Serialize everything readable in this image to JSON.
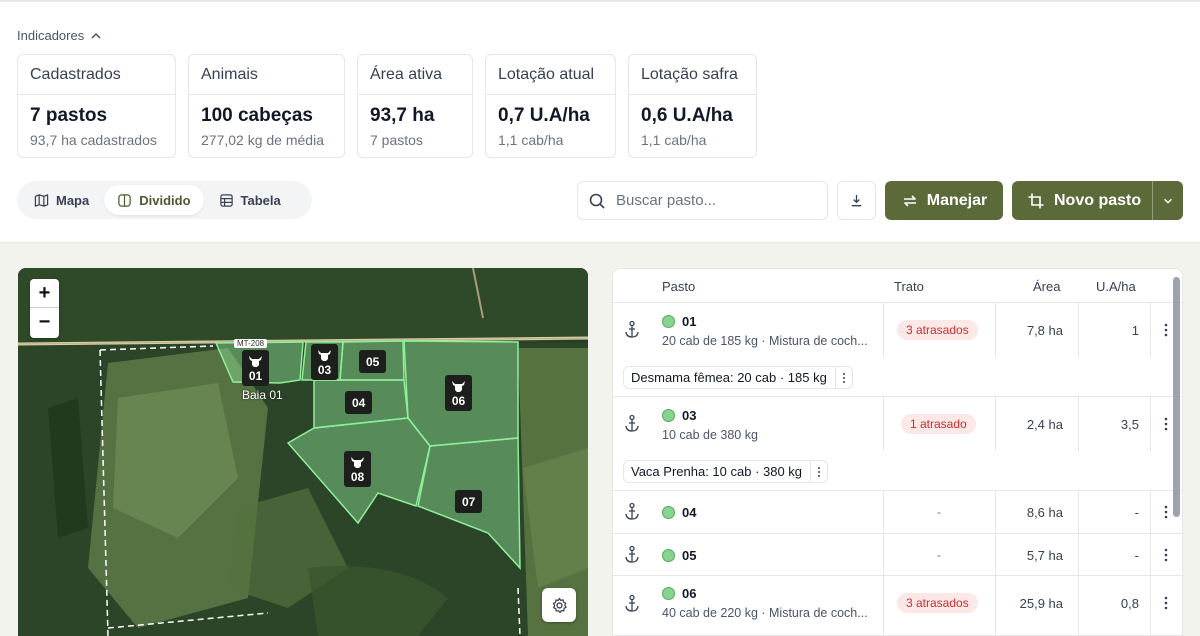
{
  "indicators": {
    "label": "Indicadores",
    "cards": [
      {
        "title": "Cadastrados",
        "value": "7 pastos",
        "sub": "93,7 ha cadastrados"
      },
      {
        "title": "Animais",
        "value": "100 cabeças",
        "sub": "277,02 kg de média"
      },
      {
        "title": "Área ativa",
        "value": "93,7 ha",
        "sub": "7 pastos"
      },
      {
        "title": "Lotação atual",
        "value": "0,7 U.A/ha",
        "sub": "1,1 cab/ha"
      },
      {
        "title": "Lotação safra",
        "value": "0,6 U.A/ha",
        "sub": "1,1 cab/ha"
      }
    ]
  },
  "view_tabs": [
    {
      "label": "Mapa",
      "icon": "map-icon"
    },
    {
      "label": "Dividido",
      "icon": "split-icon",
      "active": true
    },
    {
      "label": "Tabela",
      "icon": "table-icon"
    }
  ],
  "search": {
    "placeholder": "Buscar pasto..."
  },
  "actions": {
    "manejar": "Manejar",
    "novo_pasto": "Novo pasto"
  },
  "map": {
    "zoom_in": "+",
    "zoom_out": "−",
    "road_label": "MT-208",
    "area_label": "Baia 01",
    "markers": [
      "01",
      "03",
      "05",
      "04",
      "06",
      "08",
      "07"
    ]
  },
  "table": {
    "headers": {
      "pasto": "Pasto",
      "trato": "Trato",
      "area": "Área",
      "ua": "U.A/ha"
    },
    "rows": [
      {
        "name": "01",
        "desc": "20 cab de 185 kg · Mistura de coch...",
        "trato": "3 atrasados",
        "area": "7,8 ha",
        "ua": "1",
        "lot": "Desmama fêmea: 20 cab · 185 kg"
      },
      {
        "name": "03",
        "desc": "10 cab de 380 kg",
        "trato": "1 atrasado",
        "area": "2,4 ha",
        "ua": "3,5",
        "lot": "Vaca Prenha: 10 cab · 380 kg"
      },
      {
        "name": "04",
        "desc": "",
        "trato": "-",
        "area": "8,6 ha",
        "ua": "-"
      },
      {
        "name": "05",
        "desc": "",
        "trato": "-",
        "area": "5,7 ha",
        "ua": "-"
      },
      {
        "name": "06",
        "desc": "40 cab de 220 kg · Mistura de coch...",
        "trato": "3 atrasados",
        "area": "25,9 ha",
        "ua": "0,8"
      }
    ]
  },
  "colors": {
    "brand_green": "#5b6a38",
    "pasture_dot": "#86d48f",
    "late_badge_bg": "#fde8e8",
    "late_badge_text": "#c53030"
  }
}
